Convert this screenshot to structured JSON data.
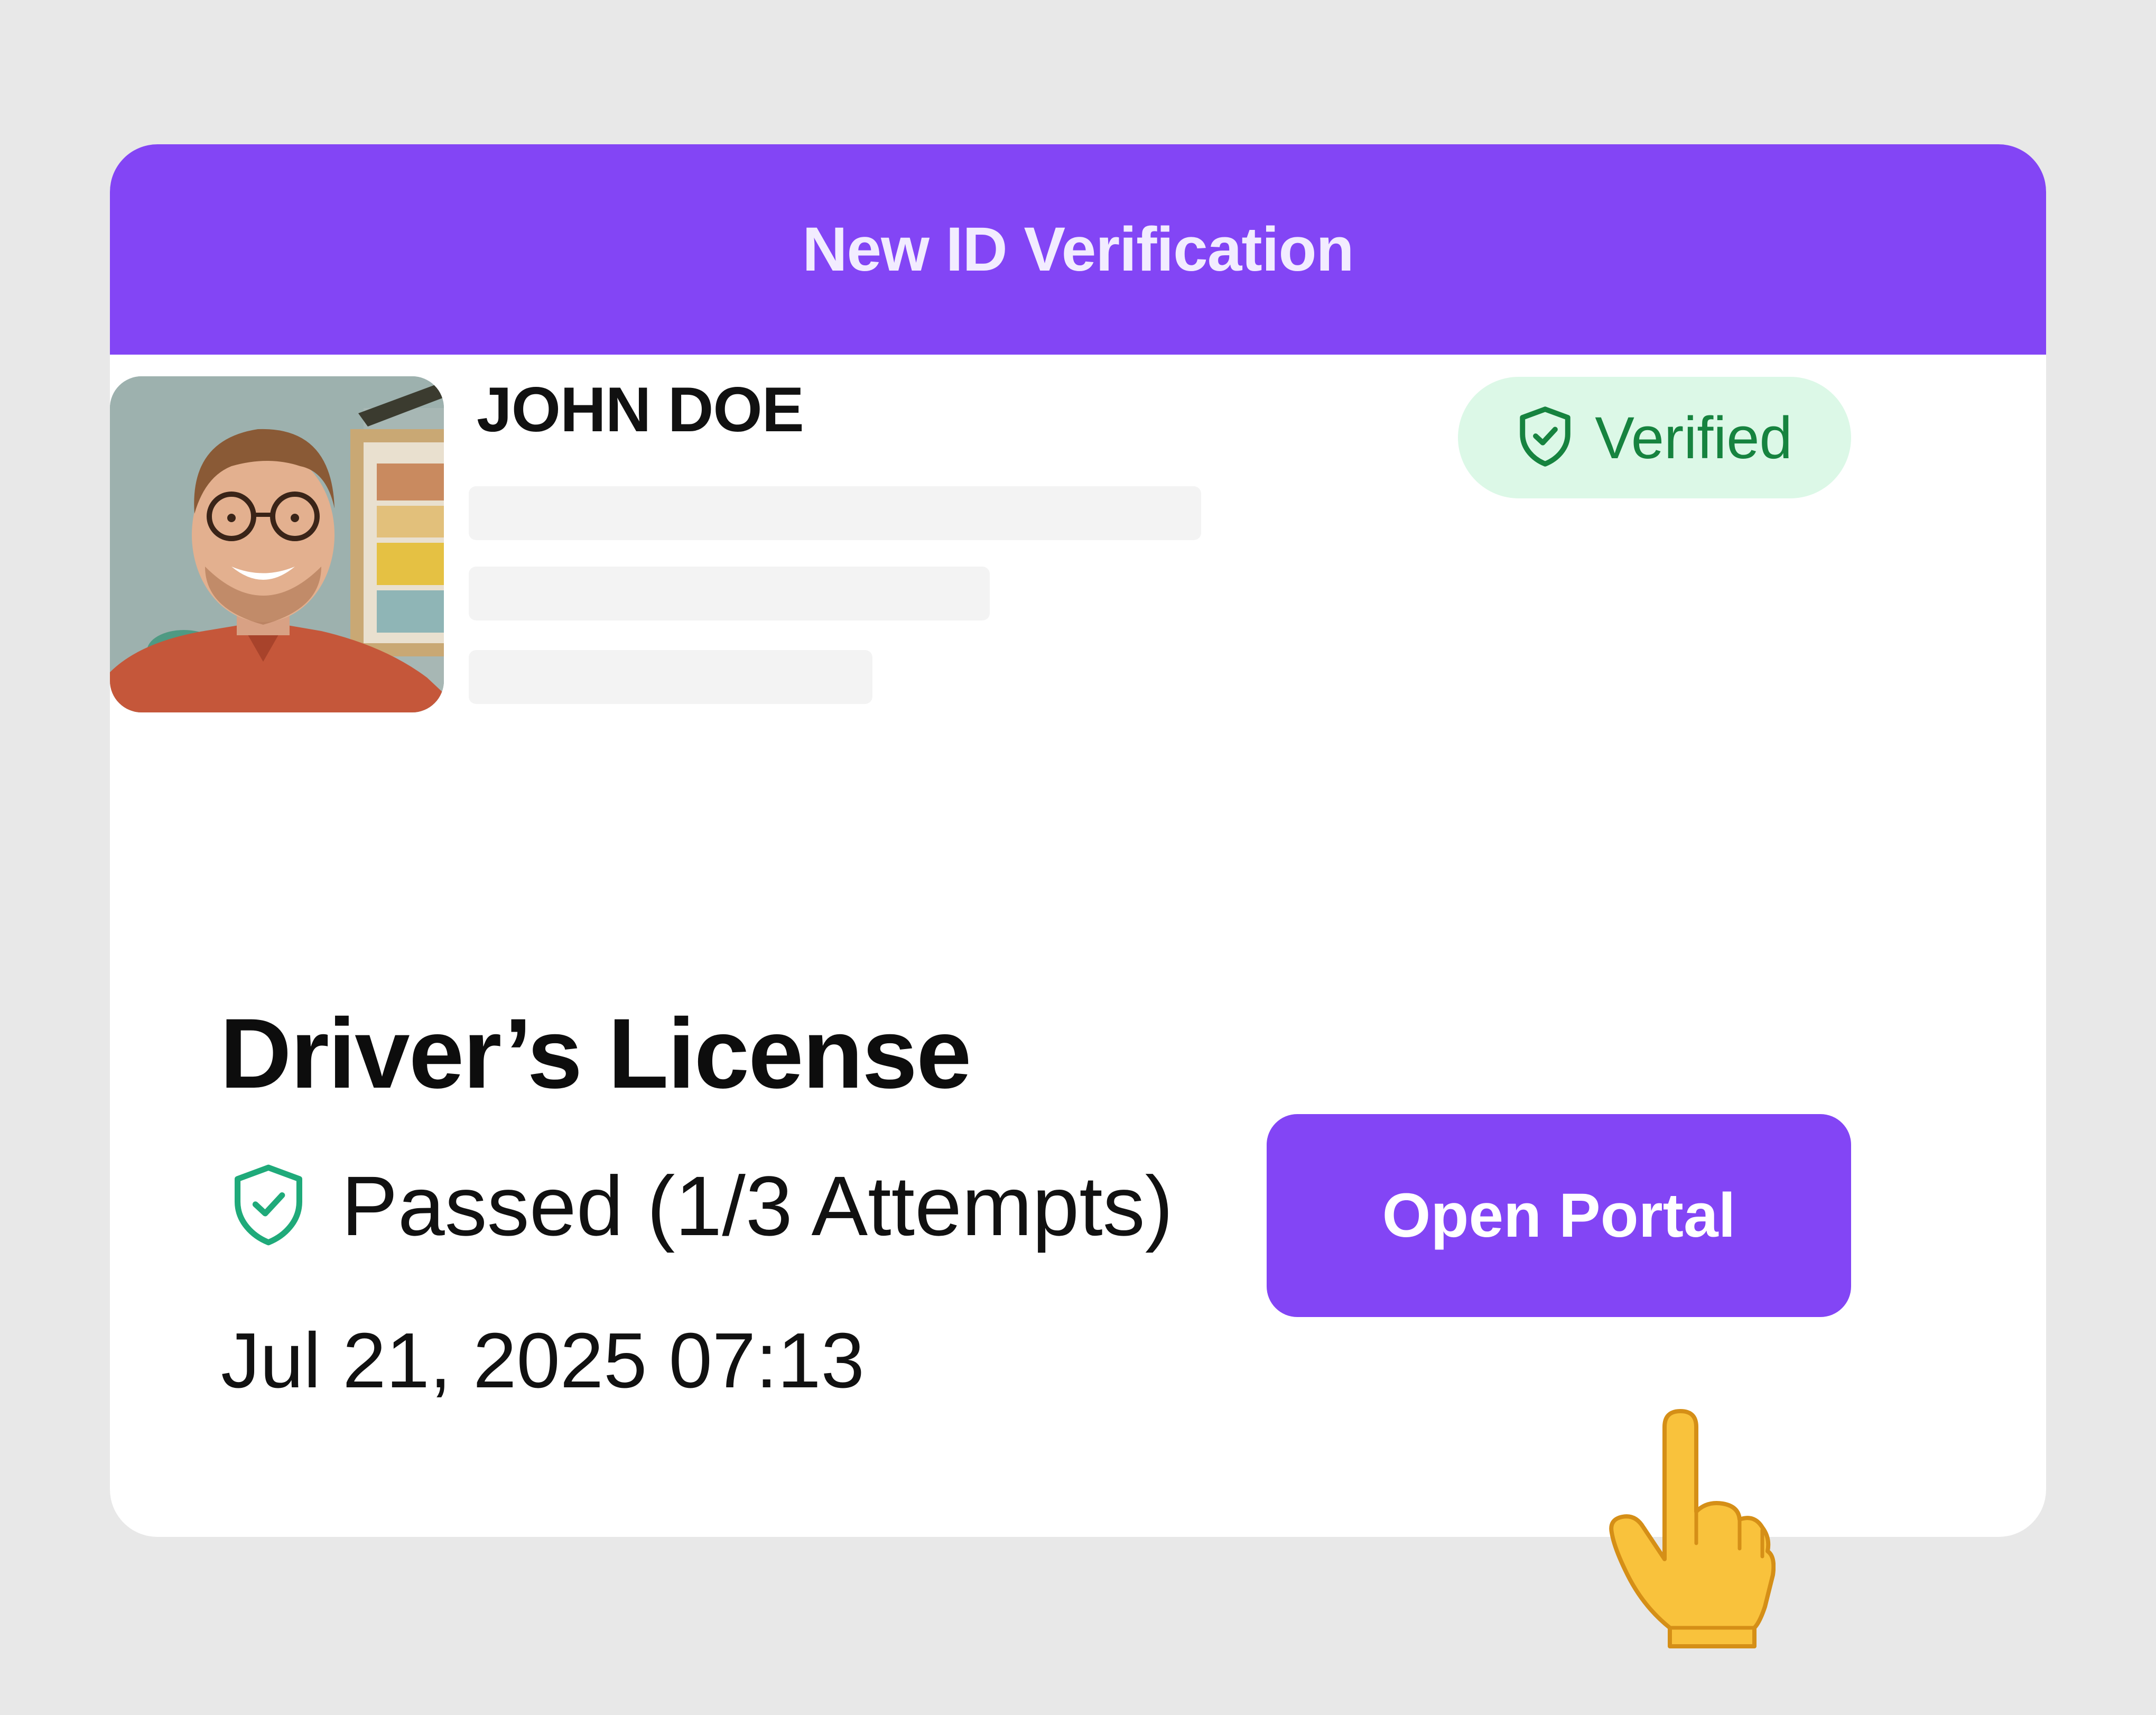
{
  "header": {
    "title": "New ID Verification"
  },
  "profile": {
    "name": "JOHN DOE"
  },
  "badge": {
    "label": "Verified",
    "icon": "shield-check-icon",
    "color": "#16833f"
  },
  "document": {
    "type": "Driver’s License",
    "status": "Passed (1/3 Attempts)",
    "status_icon": "shield-check-icon",
    "timestamp": "Jul 21, 2025 07:13"
  },
  "actions": {
    "open_portal": "Open Portal"
  },
  "colors": {
    "accent": "#8345f5",
    "success": "#1faa7a",
    "badge_bg": "#dcf8e7"
  },
  "cursor": {
    "icon": "pointing-hand-icon"
  }
}
